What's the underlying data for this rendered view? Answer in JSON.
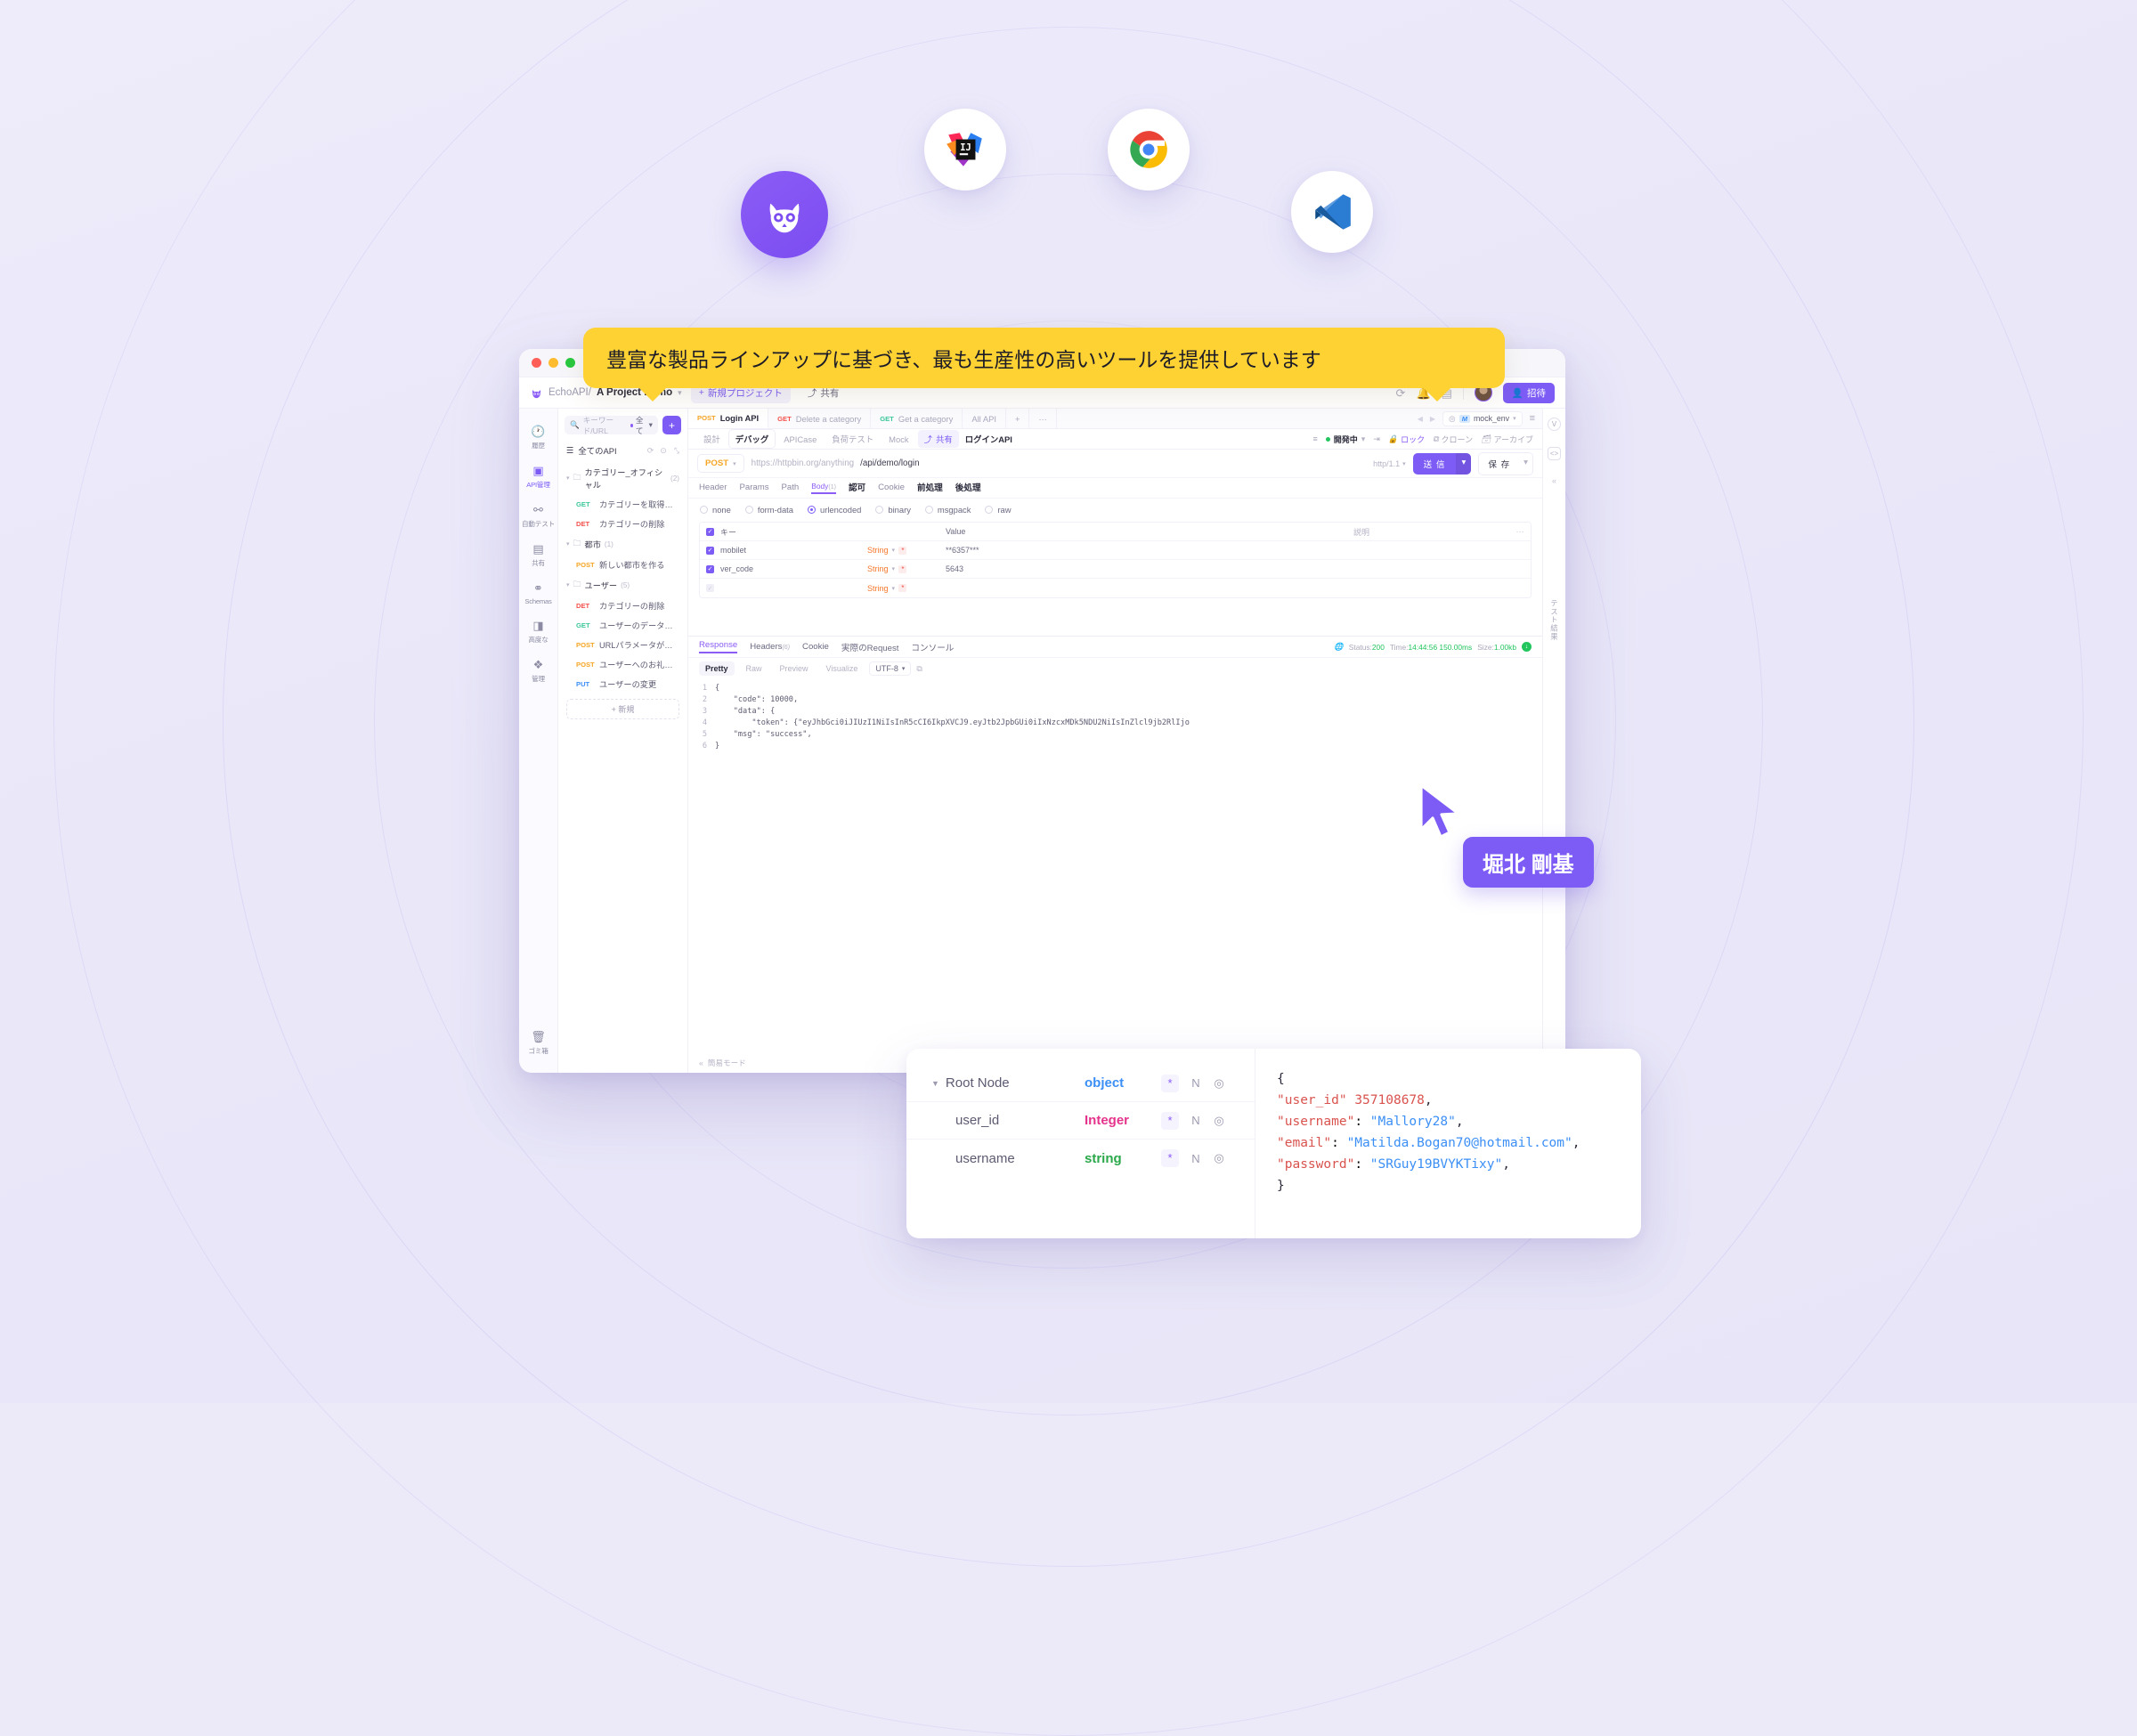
{
  "tooltip": {
    "text": "豊富な製品ラインアップに基づき、最も生産性の高いツールを提供しています"
  },
  "name_badge": {
    "text": "堀北 剛基"
  },
  "app_icons": [
    {
      "name": "echoapi",
      "label": "EchoAPI"
    },
    {
      "name": "intellij-idea",
      "label": "IntelliJ IDEA"
    },
    {
      "name": "google-chrome",
      "label": "Chrome"
    },
    {
      "name": "vscode",
      "label": "VS Code"
    }
  ],
  "header": {
    "brand": "EchoAPI/",
    "project": "A Project Demo",
    "new_project": "新規プロジェクト",
    "share": "共有",
    "invite": "招待",
    "icons": {
      "refresh": "refresh-icon",
      "bell": "bell-icon",
      "doc": "doc-icon"
    }
  },
  "rail": {
    "items": [
      {
        "icon": "history-icon",
        "label": "履歴",
        "active": false
      },
      {
        "icon": "api-icon",
        "label": "API管理",
        "active": true
      },
      {
        "icon": "autotest-icon",
        "label": "自動テスト",
        "active": false
      },
      {
        "icon": "share-icon",
        "label": "共有",
        "active": false
      },
      {
        "icon": "schemas-icon",
        "label": "Schemas",
        "active": false
      },
      {
        "icon": "advanced-icon",
        "label": "高度な",
        "active": false
      },
      {
        "icon": "manage-icon",
        "label": "管理",
        "active": false
      }
    ],
    "trash": {
      "icon": "trash-icon",
      "label": "ゴミ箱"
    }
  },
  "tree": {
    "search_placeholder": "キーワード/URL",
    "filter_label": "全て",
    "add_label": "+",
    "root_label": "全てのAPI",
    "nodes": [
      {
        "type": "folder",
        "label": "カテゴリー_オフィシャル",
        "count": "(2)"
      },
      {
        "type": "leaf",
        "method": "GET",
        "label": "カテゴリーを取得する"
      },
      {
        "type": "leaf",
        "method": "DET",
        "label": "カテゴリーの削除"
      },
      {
        "type": "folder",
        "label": "都市",
        "count": "(1)"
      },
      {
        "type": "leaf",
        "method": "POST",
        "label": "新しい都市を作る"
      },
      {
        "type": "folder",
        "label": "ユーザー",
        "count": "(5)"
      },
      {
        "type": "leaf",
        "method": "DET",
        "label": "カテゴリーの削除"
      },
      {
        "type": "leaf",
        "method": "GET",
        "label": "ユーザーのデータを読む"
      },
      {
        "type": "leaf",
        "method": "POST",
        "label": "URLパラメータが見つか"
      },
      {
        "type": "leaf",
        "method": "POST",
        "label": "ユーザーへのお礼：これ..."
      },
      {
        "type": "leaf",
        "method": "PUT",
        "label": "ユーザーの変更"
      }
    ],
    "new_label": "新規"
  },
  "tabs": [
    {
      "method": "POST",
      "label": "Login API",
      "active": true
    },
    {
      "method": "GET",
      "label": "Delete a category",
      "active": false
    },
    {
      "method": "GET",
      "label": "Get a category",
      "active": false
    },
    {
      "method": "",
      "label": "All API",
      "active": false
    }
  ],
  "tabbar": {
    "add": "+",
    "more": "···",
    "prev": "◀",
    "next": "▶",
    "env": "mock_env",
    "env_badge": "M",
    "menu": "≡"
  },
  "subtabs": {
    "items": [
      {
        "label": "設計",
        "active": false
      },
      {
        "label": "デバッグ",
        "active": true
      },
      {
        "label": "APICase",
        "active": false
      },
      {
        "label": "負荷テスト",
        "active": false
      },
      {
        "label": "Mock",
        "active": false
      }
    ],
    "share": "共有",
    "api_title": "ログインAPI",
    "status": "開発中",
    "lock": "ロック",
    "clone": "クローン",
    "archive": "アーカイブ"
  },
  "url": {
    "method": "POST",
    "host": "https://httpbin.org/anything",
    "path": "/api/demo/login",
    "http_version": "http/1.1",
    "send": "送 信",
    "save": "保 存"
  },
  "request": {
    "tabs": [
      {
        "label": "Header",
        "state": "normal"
      },
      {
        "label": "Params",
        "state": "normal"
      },
      {
        "label": "Path",
        "state": "normal"
      },
      {
        "label": "Body",
        "state": "active",
        "sup": "(1)"
      },
      {
        "label": "認可",
        "state": "bold"
      },
      {
        "label": "Cookie",
        "state": "normal"
      },
      {
        "label": "前処理",
        "state": "bold"
      },
      {
        "label": "後処理",
        "state": "bold"
      }
    ],
    "body_types": [
      {
        "label": "none",
        "selected": false
      },
      {
        "label": "form-data",
        "selected": false
      },
      {
        "label": "urlencoded",
        "selected": true
      },
      {
        "label": "binary",
        "selected": false
      },
      {
        "label": "msgpack",
        "selected": false
      },
      {
        "label": "raw",
        "selected": false
      }
    ],
    "table": {
      "headers": {
        "key": "キー",
        "value": "Value",
        "desc": "説明",
        "more": "···"
      },
      "rows": [
        {
          "checked": true,
          "key": "mobilet",
          "type": "String",
          "required": "*",
          "value": "**6357***",
          "desc": ""
        },
        {
          "checked": true,
          "key": "ver_code",
          "type": "String",
          "required": "*",
          "value": "5643",
          "desc": ""
        },
        {
          "checked": false,
          "key": "",
          "type": "String",
          "required": "*",
          "value": "",
          "desc": ""
        }
      ]
    }
  },
  "response": {
    "tabs": [
      {
        "label": "Response",
        "active": true,
        "sup": ""
      },
      {
        "label": "Headers",
        "active": false,
        "sup": "(6)"
      },
      {
        "label": "Cookie",
        "active": false,
        "sup": ""
      },
      {
        "label": "実際のRequest",
        "active": false,
        "sup": ""
      },
      {
        "label": "コンソール",
        "active": false,
        "sup": ""
      }
    ],
    "meta": {
      "status_label": "Status:",
      "status": "200",
      "time_label": "Time:",
      "time": "14:44:56 150.00ms",
      "size_label": "Size:",
      "size": "1.00kb"
    },
    "formats": [
      {
        "label": "Pretty",
        "active": true
      },
      {
        "label": "Raw",
        "active": false
      },
      {
        "label": "Preview",
        "active": false
      },
      {
        "label": "Visualize",
        "active": false
      }
    ],
    "encoding": "UTF-8",
    "code_lines": [
      {
        "n": "1",
        "text": "{"
      },
      {
        "n": "2",
        "text": "    \"code\": 10000,"
      },
      {
        "n": "3",
        "text": "    \"data\": {"
      },
      {
        "n": "4",
        "text": "        \"token\": {\"eyJhbGci0iJIUzI1NiIsInR5cCI6IkpXVCJ9.eyJtb2JpbGUi0iIxNzcxMDk5NDU2NiIsInZlcl9jb2RlIjo"
      },
      {
        "n": "5",
        "text": "    \"msg\": \"success\","
      },
      {
        "n": "6",
        "text": "}"
      }
    ],
    "simple_mode": "簡易モード",
    "vertical_label": "テスト結果"
  },
  "schema_card": {
    "rows": [
      {
        "name": "Root Node",
        "type": "object",
        "type_class": "object",
        "star": "*",
        "n": "N",
        "gear": "gear-icon",
        "indent": "root"
      },
      {
        "name": "user_id",
        "type": "Integer",
        "type_class": "integer",
        "star": "*",
        "n": "N",
        "gear": "gear-icon",
        "indent": "indent"
      },
      {
        "name": "username",
        "type": "string",
        "type_class": "string",
        "star": "*",
        "n": "N",
        "gear": "gear-icon",
        "indent": "indent"
      }
    ],
    "json_lines": [
      {
        "text": "{"
      },
      {
        "key": "\"user_id\"",
        "sep": " ",
        "val": "357108678",
        "val_class": "jn",
        "tail": ","
      },
      {
        "key": "\"username\"",
        "sep": ": ",
        "val": "\"Mallory28\"",
        "val_class": "jv",
        "tail": ","
      },
      {
        "key": "\"email\"",
        "sep": ": ",
        "val": "\"Matilda.Bogan70@hotmail.com\"",
        "val_class": "jv",
        "tail": ","
      },
      {
        "key": "\"password\"",
        "sep": ": ",
        "val": "\"SRGuy19BVYKTixy\"",
        "val_class": "jv",
        "tail": ","
      },
      {
        "text": "}"
      }
    ]
  }
}
